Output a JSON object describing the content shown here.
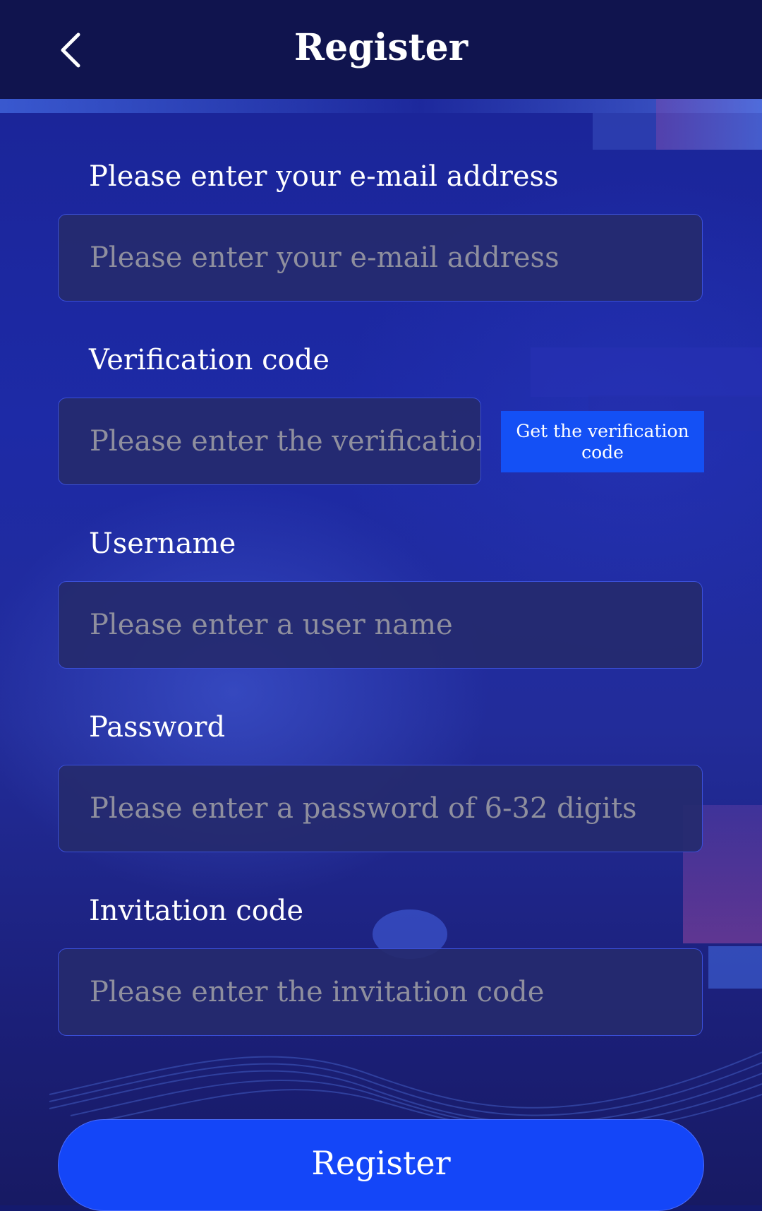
{
  "header": {
    "title": "Register",
    "back_icon": "chevron-left-icon"
  },
  "form": {
    "email": {
      "label": "Please enter your e-mail address",
      "placeholder": "Please enter your e-mail address",
      "value": ""
    },
    "verification": {
      "label": "Verification code",
      "placeholder": "Please enter the verification code",
      "value": "",
      "button_label": "Get the verification code"
    },
    "username": {
      "label": "Username",
      "placeholder": "Please enter a user name",
      "value": ""
    },
    "password": {
      "label": "Password",
      "placeholder": "Please enter a password of 6-32 digits",
      "value": ""
    },
    "invitation": {
      "label": "Invitation code",
      "placeholder": "Please enter the invitation code",
      "value": ""
    },
    "submit_label": "Register"
  },
  "colors": {
    "header_bg": "#10144e",
    "accent": "#1446f8",
    "input_bg": "#252a6e",
    "input_border": "#3a4fd8",
    "placeholder": "#8f8f9e"
  }
}
